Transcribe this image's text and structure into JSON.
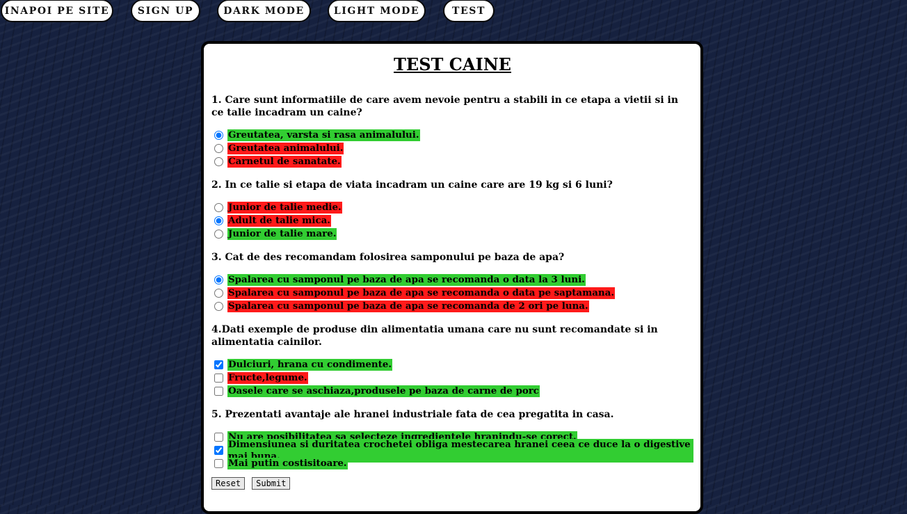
{
  "nav": {
    "back": "INAPOI PE SITE",
    "signup": "SIGN UP",
    "dark": "DARK MODE",
    "light": "LIGHT MODE",
    "test": "TEST"
  },
  "title": "TEST CAINE",
  "colors": {
    "correct": "#32cd32",
    "wrong": "#ff1a1a",
    "background": "#16213f"
  },
  "questions": [
    {
      "text": "1. Care sunt informatiile de care avem nevoie pentru a stabili in ce etapa a vietii si in ce talie incadram un caine?",
      "type": "radio",
      "options": [
        {
          "label": "Greutatea, varsta si rasa animalului.",
          "checked": true,
          "status": "correct"
        },
        {
          "label": "Greutatea animalului.",
          "checked": false,
          "status": "wrong"
        },
        {
          "label": "Carnetul de sanatate.",
          "checked": false,
          "status": "wrong"
        }
      ]
    },
    {
      "text": "2. In ce talie si etapa de viata incadram un caine care are 19 kg si 6 luni?",
      "type": "radio",
      "options": [
        {
          "label": "Junior de talie medie.",
          "checked": false,
          "status": "wrong"
        },
        {
          "label": "Adult de talie mica.",
          "checked": true,
          "status": "wrong"
        },
        {
          "label": "Junior de talie mare.",
          "checked": false,
          "status": "correct"
        }
      ]
    },
    {
      "text": "3. Cat de des recomandam folosirea samponului pe baza de apa?",
      "type": "radio",
      "options": [
        {
          "label": "Spalarea cu samponul pe baza de apa se recomanda o data la 3 luni.",
          "checked": true,
          "status": "correct"
        },
        {
          "label": "Spalarea cu samponul pe baza de apa se recomanda o data pe saptamana.",
          "checked": false,
          "status": "wrong"
        },
        {
          "label": "Spalarea cu samponul pe baza de apa se recomanda de 2 ori pe luna.",
          "checked": false,
          "status": "wrong"
        }
      ]
    },
    {
      "text": "4.Dati exemple de produse din alimentatia umana care nu sunt recomandate si in alimentatia cainilor.",
      "type": "checkbox",
      "options": [
        {
          "label": "Dulciuri, hrana cu condimente.",
          "checked": true,
          "status": "correct"
        },
        {
          "label": "Fructe,legume.",
          "checked": false,
          "status": "wrong"
        },
        {
          "label": "Oasele care se aschiaza,produsele pe baza de carne de porc",
          "checked": false,
          "status": "correct"
        }
      ]
    },
    {
      "text": "5. Prezentati avantaje ale hranei industriale fata de cea pregatita in casa.",
      "type": "checkbox",
      "options": [
        {
          "label": "Nu are posibilitatea sa selecteze ingredientele hranindu-se corect.",
          "checked": false,
          "status": "correct"
        },
        {
          "label": "Dimensiunea si duritatea crochetei obliga mestecarea hranei ceea ce duce la o digestive mai buna.",
          "checked": true,
          "status": "correct"
        },
        {
          "label": "Mai putin costisitoare.",
          "checked": false,
          "status": "correct"
        }
      ]
    }
  ],
  "buttons": {
    "reset": "Reset",
    "submit": "Submit"
  }
}
